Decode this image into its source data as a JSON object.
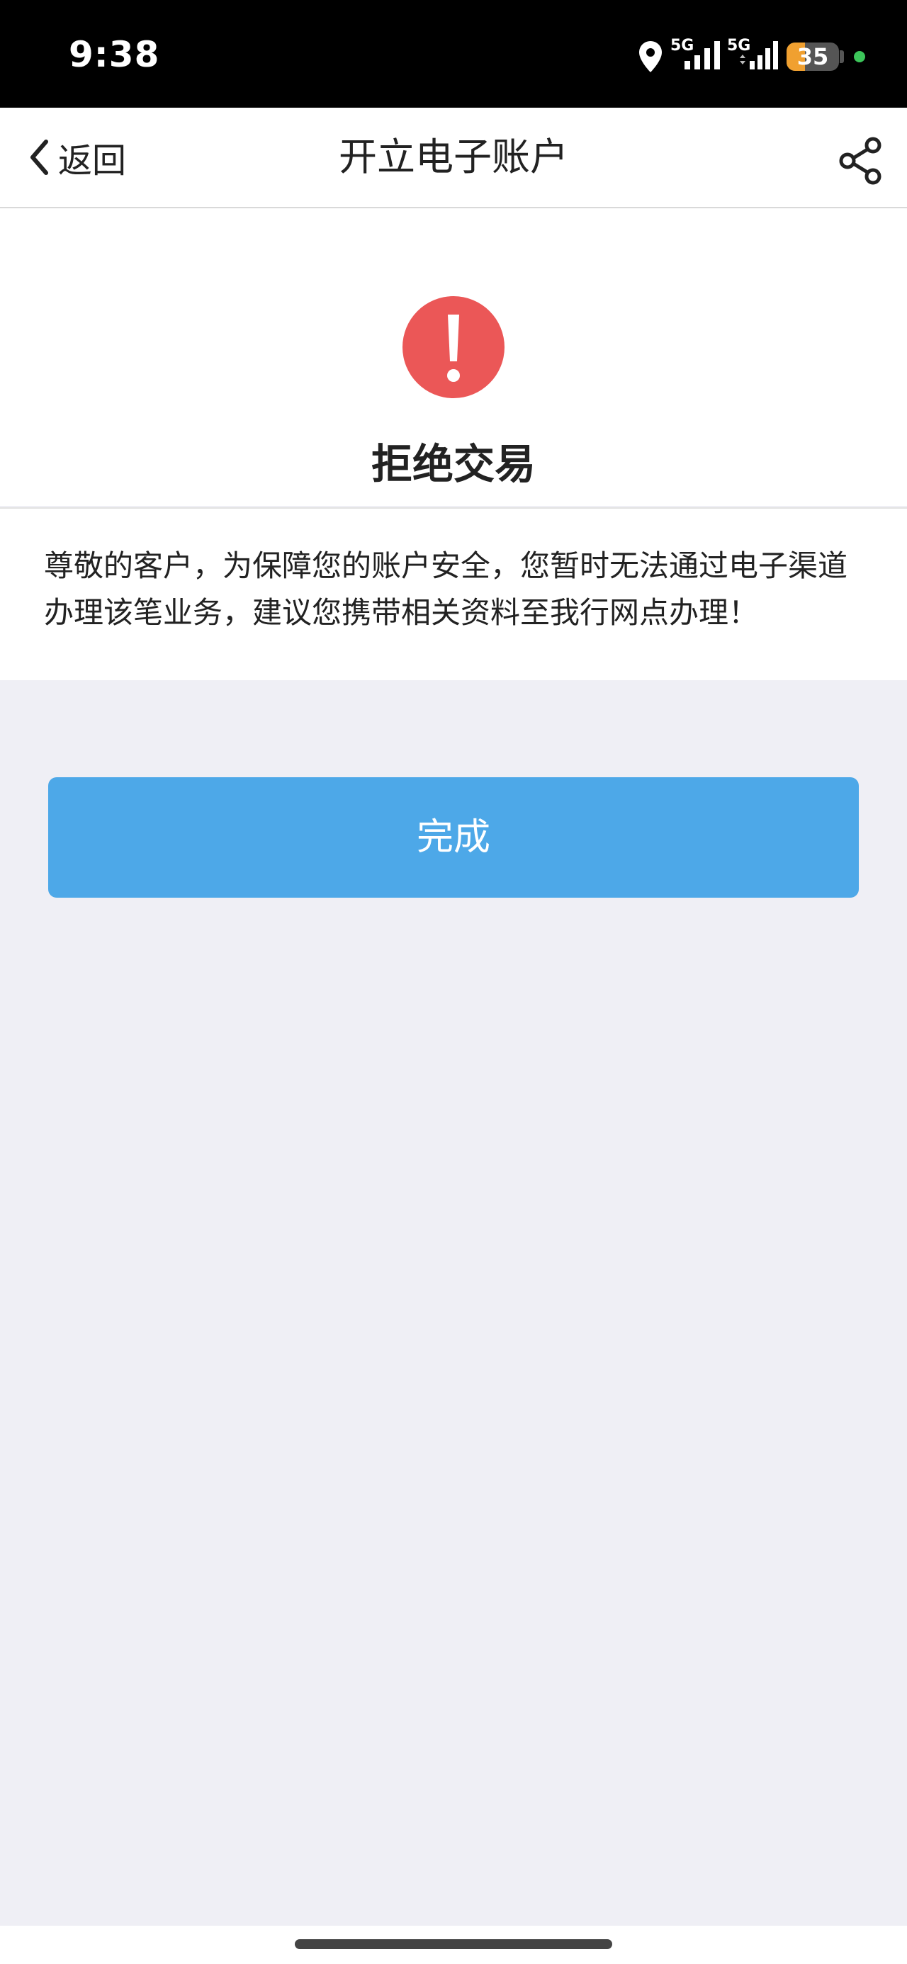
{
  "status_bar": {
    "time": "9:38",
    "signal_1": "5G",
    "signal_2": "5G",
    "battery_level": "35",
    "battery_color": "#f0a030",
    "indicator_dot_color": "#3cc55a"
  },
  "nav": {
    "back_label": "返回",
    "title": "开立电子账户",
    "share_icon": "share-icon"
  },
  "result": {
    "icon": "exclamation-circle-icon",
    "icon_color": "#eb5757",
    "title": "拒绝交易",
    "message": "尊敬的客户，为保障您的账户安全，您暂时无法通过电子渠道办理该笔业务，建议您携带相关资料至我行网点办理！"
  },
  "actions": {
    "done_label": "完成",
    "done_color": "#4da8e8"
  }
}
